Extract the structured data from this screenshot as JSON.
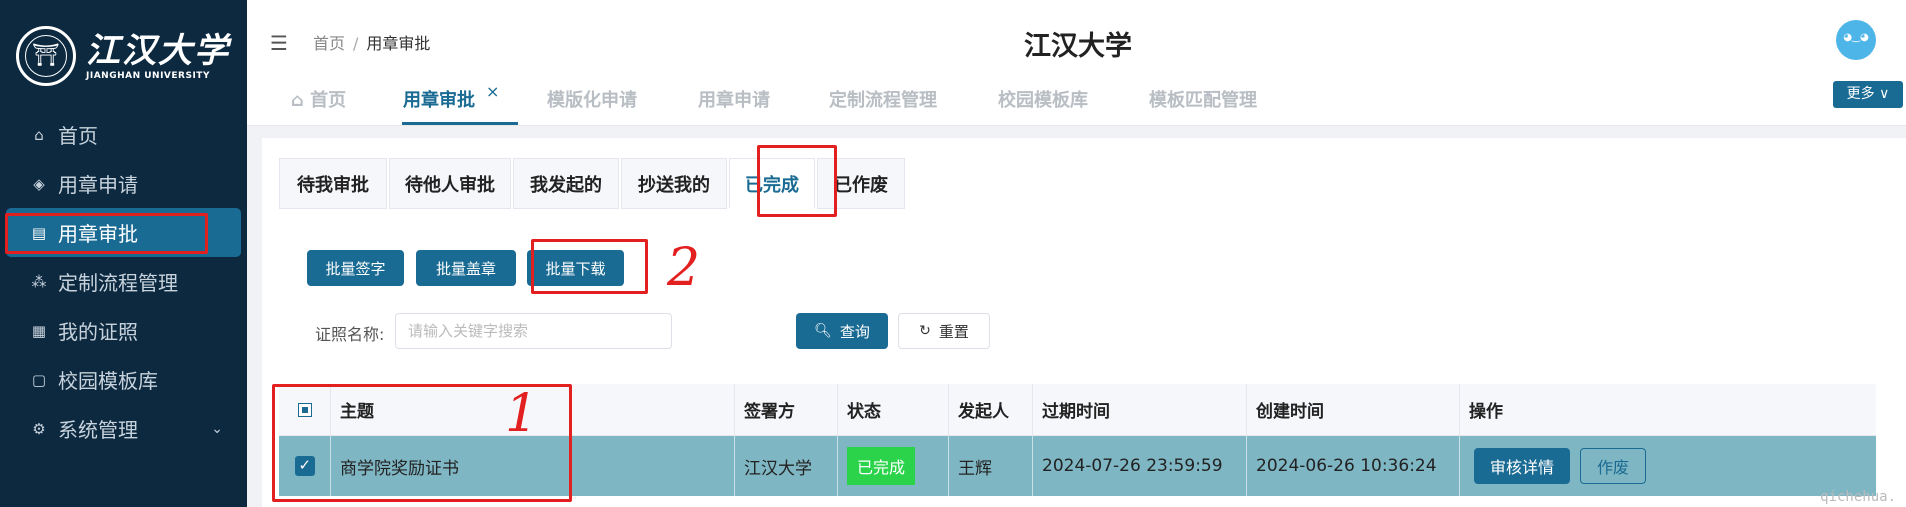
{
  "sidebar": {
    "logo_cn": "江汉大学",
    "logo_en": "JIANGHAN UNIVERSITY",
    "items": [
      {
        "label": "首页",
        "icon": "home-icon"
      },
      {
        "label": "用章申请",
        "icon": "target-icon"
      },
      {
        "label": "用章审批",
        "icon": "approve-doc-icon",
        "active": true
      },
      {
        "label": "定制流程管理",
        "icon": "flow-icon"
      },
      {
        "label": "我的证照",
        "icon": "certificate-icon"
      },
      {
        "label": "校园模板库",
        "icon": "template-icon"
      },
      {
        "label": "系统管理",
        "icon": "gear-icon",
        "expandable": true
      }
    ]
  },
  "header": {
    "breadcrumb_home": "首页",
    "breadcrumb_sep": "/",
    "breadcrumb_current": "用章审批",
    "title": "江汉大学"
  },
  "page_tabs": {
    "items": [
      "首页",
      "用章审批",
      "模版化申请",
      "用章申请",
      "定制流程管理",
      "校园模板库",
      "模板匹配管理"
    ],
    "active_index": 1,
    "close": "×",
    "more": "更多 ∨"
  },
  "status_tabs": {
    "items": [
      "待我审批",
      "待他人审批",
      "我发起的",
      "抄送我的",
      "已完成",
      "已作废"
    ],
    "active_index": 4
  },
  "batch": {
    "sign": "批量签字",
    "seal": "批量盖章",
    "download": "批量下载"
  },
  "search": {
    "label": "证照名称:",
    "placeholder": "请输入关键字搜索",
    "query": "查询",
    "reset": "重置"
  },
  "table": {
    "headers": [
      "主题",
      "签署方",
      "状态",
      "发起人",
      "过期时间",
      "创建时间",
      "操作"
    ],
    "rows": [
      {
        "subject": "商学院奖励证书",
        "signer": "江汉大学",
        "status": "已完成",
        "initiator": "王辉",
        "expire": "2024-07-26 23:59:59",
        "created": "2024-06-26 10:36:24",
        "action_detail": "审核详情",
        "action_void": "作废",
        "selected": true
      }
    ]
  },
  "annotations": {
    "mark1": "1",
    "mark2": "2",
    "color": "#e32020"
  },
  "watermark": "qichehua.",
  "colors": {
    "primary": "#1a6b93",
    "sidebar_bg": "#0c2940",
    "status_done": "#2bd34b",
    "selected_row": "#7fb6c3"
  }
}
